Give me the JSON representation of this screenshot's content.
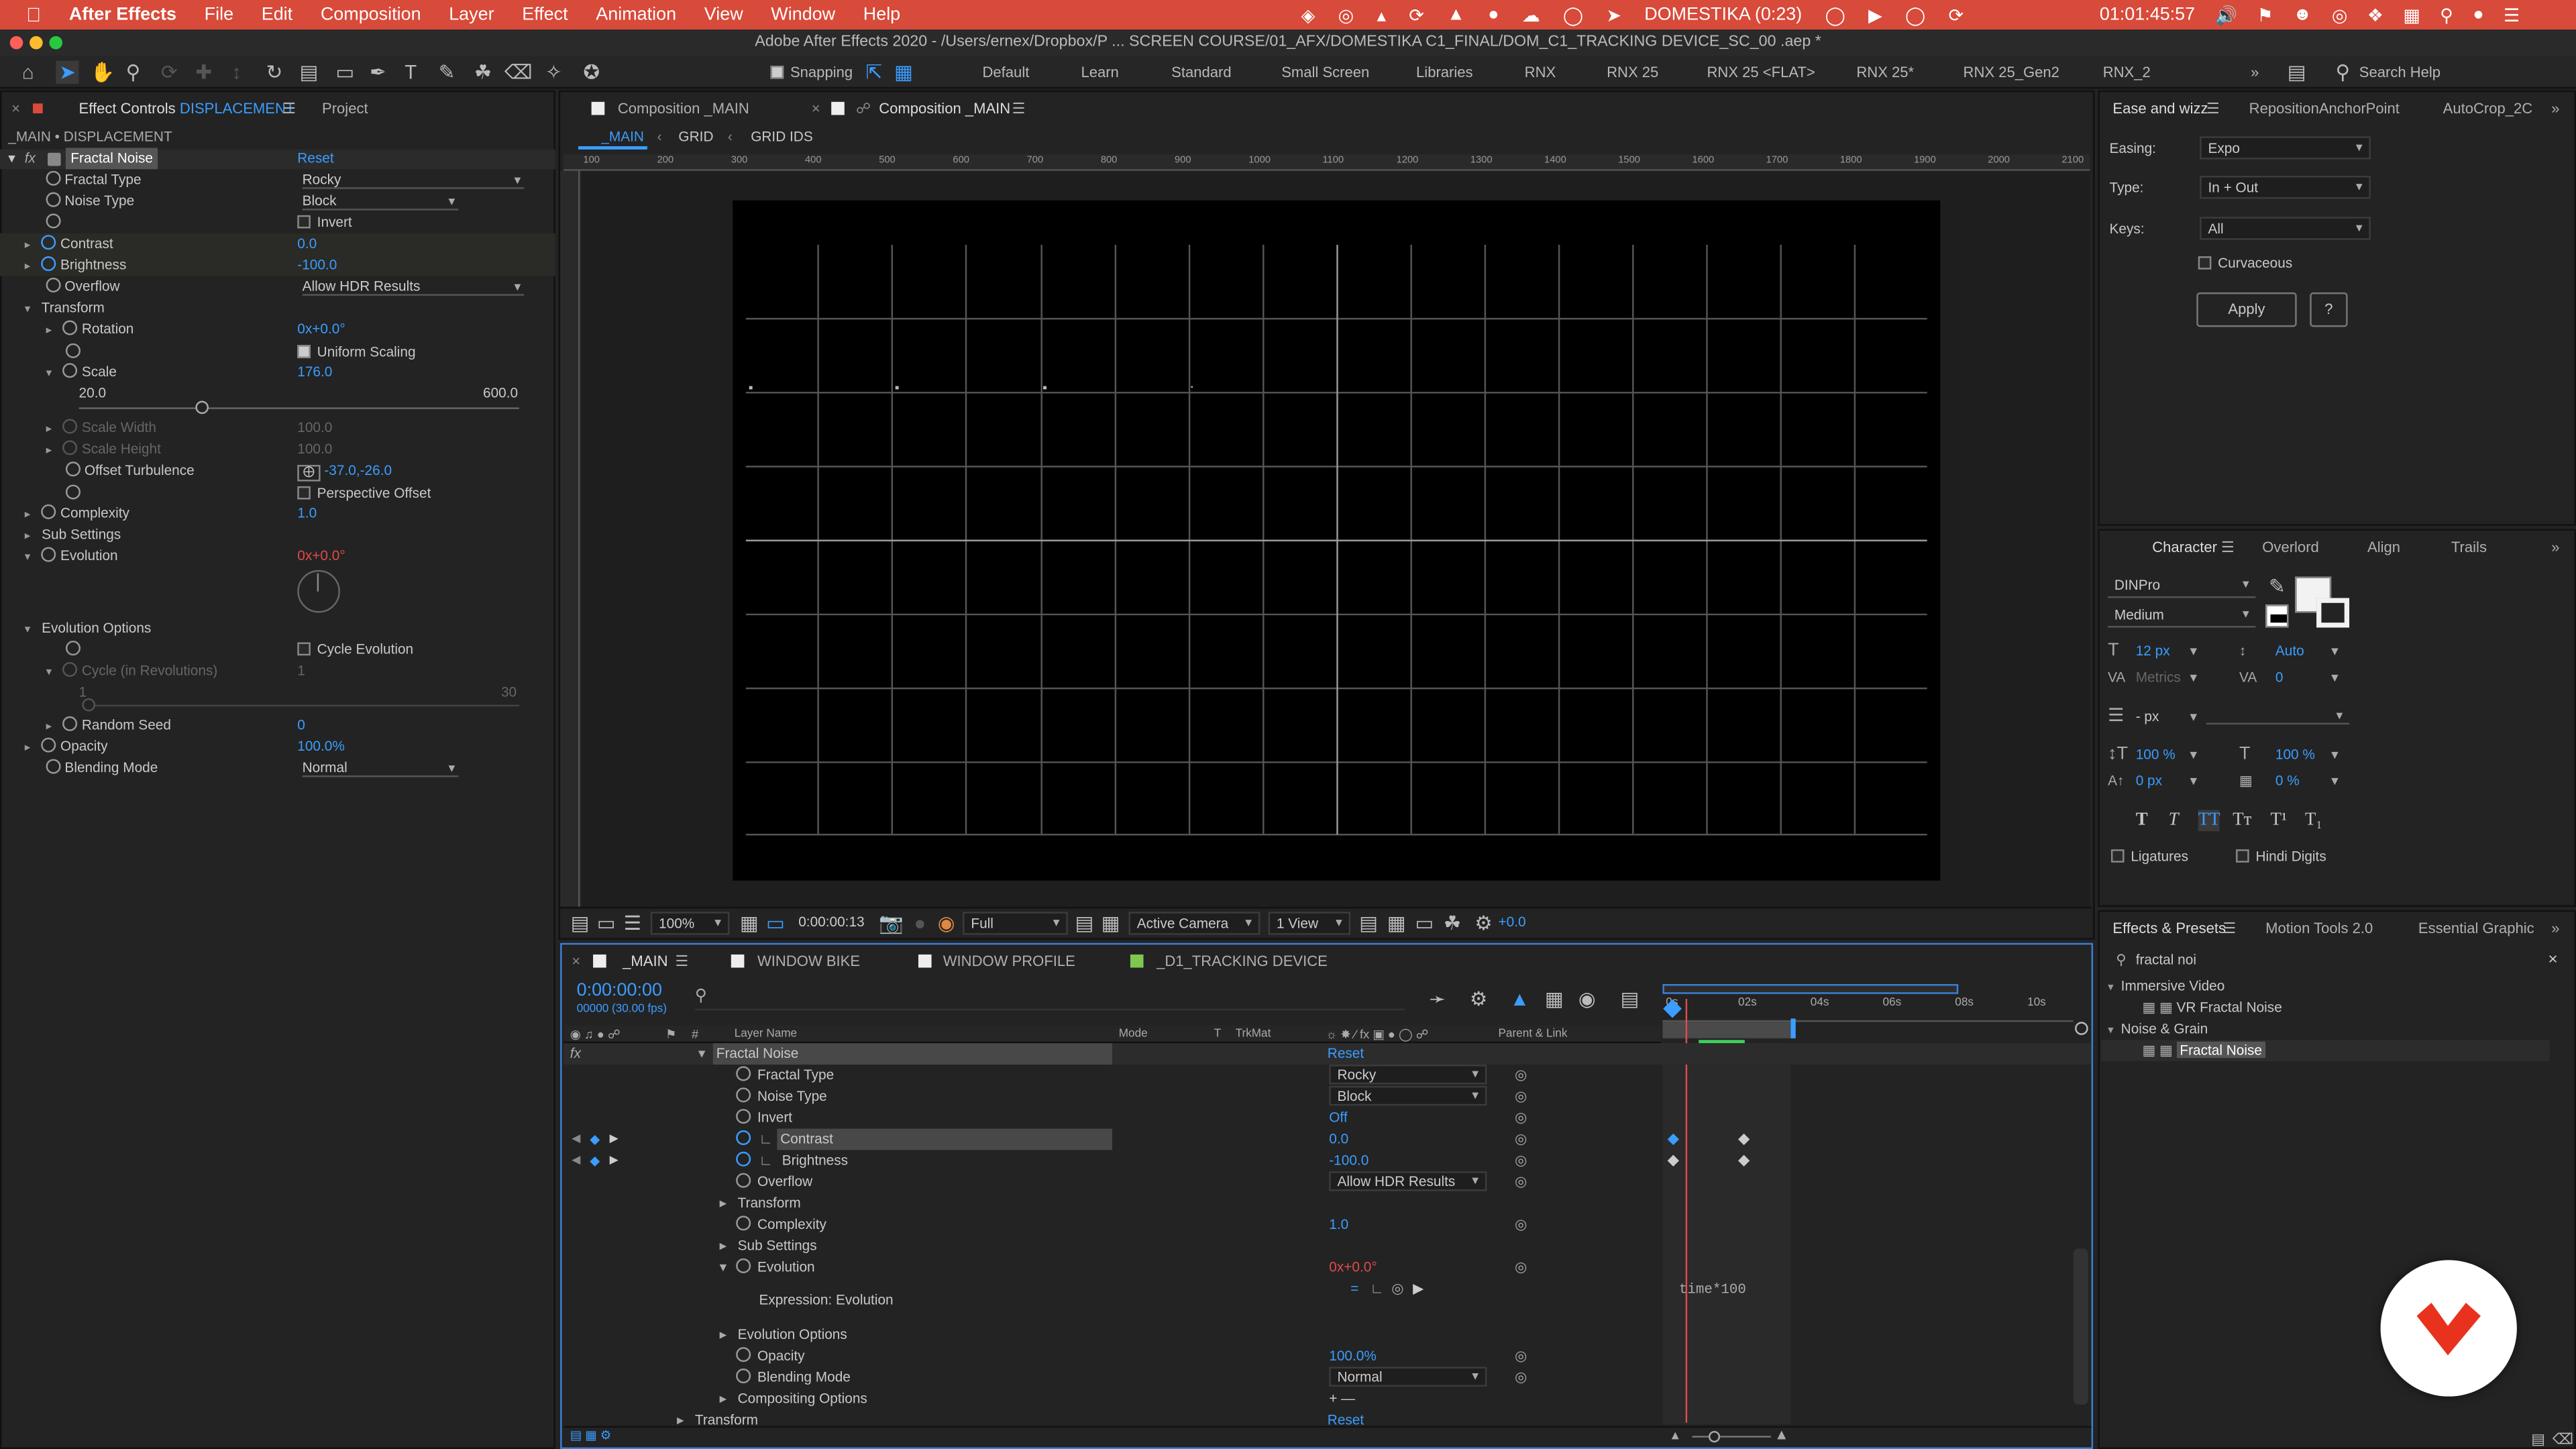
{
  "menubar": {
    "app": "After Effects",
    "items": [
      "File",
      "Edit",
      "Composition",
      "Layer",
      "Effect",
      "Animation",
      "View",
      "Window",
      "Help"
    ],
    "status": {
      "recorder": "DOMESTIKA (0:23)",
      "clock": "01:01:45:57"
    }
  },
  "titlebar": "Adobe After Effects 2020 - /Users/ernex/Dropbox/P ... SCREEN COURSE/01_AFX/DOMESTIKA C1_FINAL/DOM_C1_TRACKING DEVICE_SC_00 .aep *",
  "toolbar": {
    "snapping": "Snapping",
    "workspaces": [
      "Default",
      "Learn",
      "Standard",
      "Small Screen",
      "Libraries",
      "RNX",
      "RNX 25",
      "RNX 25 <FLAT>",
      "RNX 25*",
      "RNX 25_Gen2",
      "RNX_2"
    ],
    "search_placeholder": "Search Help"
  },
  "effect_controls": {
    "tab_label": "Effect Controls",
    "tab_layer": "DISPLACEMENT",
    "tab_project": "Project",
    "header": "_MAIN • DISPLACEMENT",
    "effect_name": "Fractal Noise",
    "reset": "Reset",
    "props": [
      {
        "label": "Fractal Type",
        "value": "Rocky"
      },
      {
        "label": "Noise Type",
        "value": "Block"
      },
      {
        "label": "Invert",
        "value": "Invert"
      },
      {
        "label": "Contrast",
        "value": "0.0"
      },
      {
        "label": "Brightness",
        "value": "-100.0"
      },
      {
        "label": "Overflow",
        "value": "Allow HDR Results"
      },
      {
        "label": "Transform",
        "value": ""
      },
      {
        "label": "Rotation",
        "value": "0x+0.0°"
      },
      {
        "label": "",
        "value": "Uniform Scaling"
      },
      {
        "label": "Scale",
        "value": "176.0"
      },
      {
        "label": "Scale Width",
        "value": "100.0"
      },
      {
        "label": "Scale Height",
        "value": "100.0"
      },
      {
        "label": "Offset Turbulence",
        "value": "-37.0,-26.0"
      },
      {
        "label": "",
        "value": "Perspective Offset"
      },
      {
        "label": "Complexity",
        "value": "1.0"
      },
      {
        "label": "Sub Settings",
        "value": ""
      },
      {
        "label": "Evolution",
        "value": "0x+0.0°"
      },
      {
        "label": "Evolution Options",
        "value": ""
      },
      {
        "label": "",
        "value": "Cycle Evolution"
      },
      {
        "label": "Cycle (in Revolutions)",
        "value": "1"
      },
      {
        "label": "Random Seed",
        "value": "0"
      },
      {
        "label": "Opacity",
        "value": "100.0%"
      },
      {
        "label": "Blending Mode",
        "value": "Normal"
      }
    ],
    "scale_slider": {
      "min": "20.0",
      "max": "600.0",
      "value": 176.0
    },
    "cycle_slider": {
      "min": "1",
      "max": "30"
    }
  },
  "composition": {
    "tabs": [
      "Composition _MAIN",
      "Composition _MAIN"
    ],
    "breadcrumbs": [
      "_MAIN",
      "GRID",
      "GRID IDS"
    ],
    "ruler_ticks": [
      "100",
      "200",
      "300",
      "400",
      "500",
      "600",
      "700",
      "800",
      "900",
      "1000",
      "1100",
      "1200",
      "1300",
      "1400",
      "1500",
      "1600",
      "1700",
      "1800",
      "1900",
      "2000",
      "2100"
    ],
    "footer": {
      "zoom": "100%",
      "timecode": "0:00:00:13",
      "resolution": "Full",
      "camera": "Active Camera",
      "view": "1 View",
      "exposure": "+0.0"
    }
  },
  "timeline": {
    "tabs": [
      "_MAIN",
      "WINDOW BIKE",
      "WINDOW PROFILE",
      "_D1_TRACKING DEVICE"
    ],
    "timecode": "0:00:00:00",
    "fps": "00000 (30.00 fps)",
    "col_headers": {
      "layer_name": "Layer Name",
      "mode": "Mode",
      "t": "T",
      "trkmat": "TrkMat",
      "parent": "Parent & Link"
    },
    "time_ticks": [
      "0s",
      "02s",
      "04s",
      "06s",
      "08s",
      "10s"
    ],
    "rows": [
      {
        "name": "Fractal Noise",
        "value": "Reset"
      },
      {
        "name": "Fractal Type",
        "value": "Rocky"
      },
      {
        "name": "Noise Type",
        "value": "Block"
      },
      {
        "name": "Invert",
        "value": "Off"
      },
      {
        "name": "Contrast",
        "value": "0.0"
      },
      {
        "name": "Brightness",
        "value": "-100.0"
      },
      {
        "name": "Overflow",
        "value": "Allow HDR Results"
      },
      {
        "name": "Transform",
        "value": ""
      },
      {
        "name": "Complexity",
        "value": "1.0"
      },
      {
        "name": "Sub Settings",
        "value": ""
      },
      {
        "name": "Evolution",
        "value": "0x+0.0°"
      },
      {
        "name": "Expression: Evolution",
        "value": ""
      },
      {
        "name": "Evolution Options",
        "value": ""
      },
      {
        "name": "Opacity",
        "value": "100.0%"
      },
      {
        "name": "Blending Mode",
        "value": "Normal"
      },
      {
        "name": "Compositing Options",
        "value": ""
      },
      {
        "name": "Transform",
        "value": "Reset"
      }
    ],
    "expression_text": "time*100"
  },
  "ease_panel": {
    "tabs": [
      "Ease and wizz",
      "RepositionAnchorPoint",
      "AutoCrop_2C"
    ],
    "easing_label": "Easing:",
    "easing": "Expo",
    "type_label": "Type:",
    "type": "In + Out",
    "keys_label": "Keys:",
    "keys": "All",
    "curvaceous": "Curvaceous",
    "apply": "Apply",
    "help": "?"
  },
  "character": {
    "tabs": [
      "Character",
      "Overlord",
      "Align",
      "Trails"
    ],
    "font": "DINPro",
    "style": "Medium",
    "size": "12 px",
    "leading": "Auto",
    "kerning": "Metrics",
    "tracking": "0",
    "stroke": "- px",
    "vscale": "100 %",
    "hscale": "100 %",
    "baseline": "0 px",
    "tsume": "0 %",
    "ligatures": "Ligatures",
    "hindi": "Hindi Digits"
  },
  "effects_presets": {
    "tabs": [
      "Effects & Presets",
      "Motion Tools 2.0",
      "Essential Graphic"
    ],
    "search": "fractal noi",
    "tree": [
      {
        "group": "Immersive Video",
        "item": "VR Fractal Noise"
      },
      {
        "group": "Noise & Grain",
        "item": "Fractal Noise"
      }
    ]
  },
  "colors": {
    "accent": "#3b9dff",
    "menubar": "#d84a3a",
    "brand": "#e8321e"
  }
}
